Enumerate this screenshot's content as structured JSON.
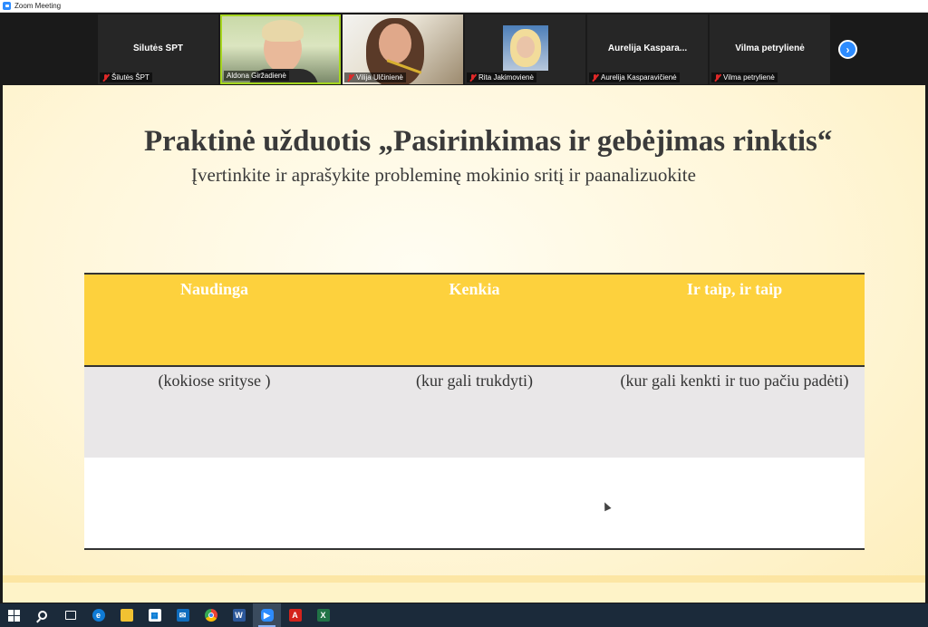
{
  "window": {
    "title": "Zoom Meeting"
  },
  "participants": [
    {
      "display_name": "Šilutės ŠPT",
      "label": "Šilutės ŠPT",
      "muted": true,
      "video": false
    },
    {
      "display_name": "",
      "label": "Aldona Giržadienė",
      "muted": false,
      "video": true,
      "active_speaker": true
    },
    {
      "display_name": "",
      "label": "Vilija Ulčinienė",
      "muted": true,
      "video": true
    },
    {
      "display_name": "",
      "label": "Rita Jakimovienė",
      "muted": true,
      "video": true
    },
    {
      "display_name": "Aurelija  Kaspara...",
      "label": "Aurelija Kasparavičienė",
      "muted": true,
      "video": false
    },
    {
      "display_name": "Vilma petrylienė",
      "label": "Vilma petrylienė",
      "muted": true,
      "video": false
    }
  ],
  "slide": {
    "title": "Praktinė užduotis „Pasirinkimas ir gebėjimas rinktis“",
    "subtitle": "Įvertinkite ir aprašykite probleminę mokinio sritį ir paanalizuokite",
    "table": {
      "headers": [
        "Naudinga",
        "Kenkia",
        "Ir taip, ir taip"
      ],
      "rows": [
        [
          "(kokiose srityse )",
          "(kur gali trukdyti)",
          "(kur gali kenkti ir tuo pačiu padėti)"
        ],
        [
          "",
          "",
          ""
        ]
      ]
    }
  },
  "taskbar": {
    "icons": [
      "windows-start-icon",
      "search-icon",
      "task-view-icon",
      "edge-icon",
      "file-explorer-icon",
      "store-icon",
      "mail-icon",
      "chrome-icon",
      "word-icon",
      "zoom-icon",
      "acrobat-icon",
      "excel-icon"
    ],
    "active": "zoom-icon"
  },
  "colors": {
    "accent": "#2d8cff",
    "header_yellow": "#fdd13d",
    "active_speaker_border": "#a6d61e",
    "muted_red": "#e02828"
  }
}
